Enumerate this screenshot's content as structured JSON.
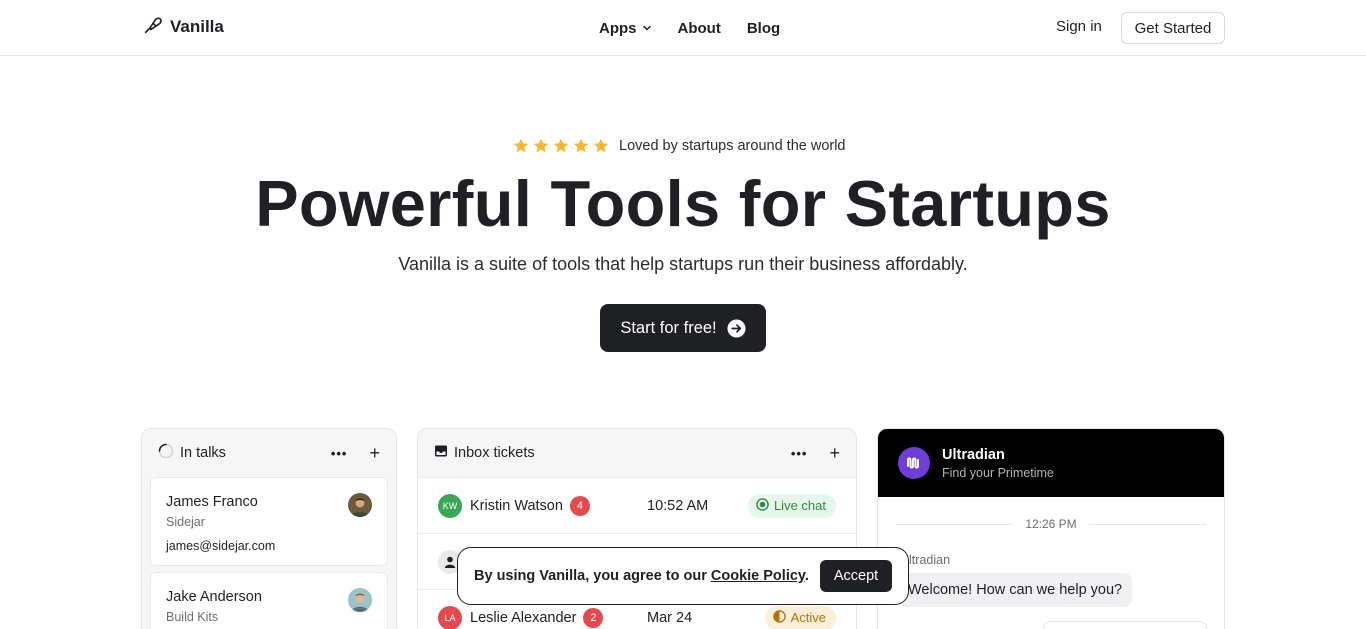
{
  "nav": {
    "logo_text": "Vanilla",
    "links": [
      {
        "label": "Apps"
      },
      {
        "label": "About"
      },
      {
        "label": "Blog"
      }
    ],
    "signin_label": "Sign in",
    "cta_label": "Get Started"
  },
  "hero": {
    "rating": 5,
    "rating_text": "Loved by startups around the world",
    "title": "Powerful Tools for Startups",
    "subtitle": "Vanilla is a suite of tools that help startups run their business affordably.",
    "cta_label": "Start for free!"
  },
  "talks": {
    "title": "In talks",
    "contacts": [
      {
        "name": "James Franco",
        "company": "Sidejar",
        "email": "james@sidejar.com"
      },
      {
        "name": "Jake Anderson",
        "company": "Build Kits",
        "email": ""
      }
    ]
  },
  "inbox": {
    "title": "Inbox tickets",
    "tickets": [
      {
        "initials": "KW",
        "name": "Kristin Watson",
        "count": "4",
        "time": "10:52 AM",
        "status": "Live chat",
        "avatar_color": "#3aa657"
      },
      {
        "initials": "",
        "name": "",
        "count": "",
        "time": "",
        "status": "",
        "avatar_color": "#e9e9eb"
      },
      {
        "initials": "LA",
        "name": "Leslie Alexander",
        "count": "2",
        "time": "Mar 24",
        "status": "Active",
        "avatar_color": "#e5484d"
      }
    ]
  },
  "ultradian": {
    "name": "Ultradian",
    "tagline": "Find your Primetime",
    "divider_time": "12:26 PM",
    "sender": "Ultradian",
    "message": "Welcome! How can we help you?"
  },
  "cookie": {
    "text_before": "By using Vanilla, you agree to our ",
    "link": "Cookie Policy",
    "text_after": ".",
    "accept_label": "Accept"
  },
  "colors": {
    "dark": "#1f2023",
    "star": "#f5b82e",
    "ultradian_brand": "#6e3fd8",
    "live_green": "#2f8a44",
    "active_amber": "#b07311"
  }
}
